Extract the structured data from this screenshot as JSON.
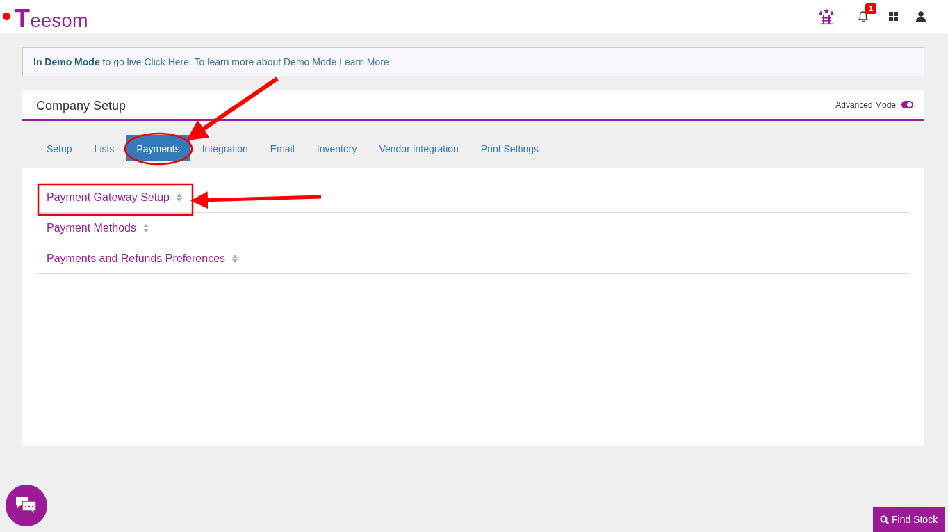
{
  "header": {
    "logo": "Teesom",
    "notification_count": "1"
  },
  "banner": {
    "parts": [
      {
        "kind": "text",
        "text": "**In Demo Mode** to go live "
      },
      {
        "kind": "link",
        "text": "Click Here"
      },
      {
        "kind": "text",
        "text": ". To learn more about Demo Mode "
      },
      {
        "kind": "link",
        "text": "Learn More"
      }
    ]
  },
  "page": {
    "title": "Company Setup",
    "advanced_mode": {
      "label": "Advanced Mode",
      "on": true
    }
  },
  "tabs": [
    {
      "label": "Setup",
      "selected": false
    },
    {
      "label": "Lists",
      "selected": false
    },
    {
      "label": "Payments",
      "selected": true
    },
    {
      "label": "Integration",
      "selected": false
    },
    {
      "label": "Email",
      "selected": false
    },
    {
      "label": "Inventory",
      "selected": false
    },
    {
      "label": "Vendor Integration",
      "selected": false
    },
    {
      "label": "Print Settings",
      "selected": false
    }
  ],
  "sections": [
    {
      "label": "Payment Gateway Setup"
    },
    {
      "label": "Payment Methods"
    },
    {
      "label": "Payments and Refunds Preferences"
    }
  ],
  "find_stock": {
    "label": "Find Stock"
  }
}
